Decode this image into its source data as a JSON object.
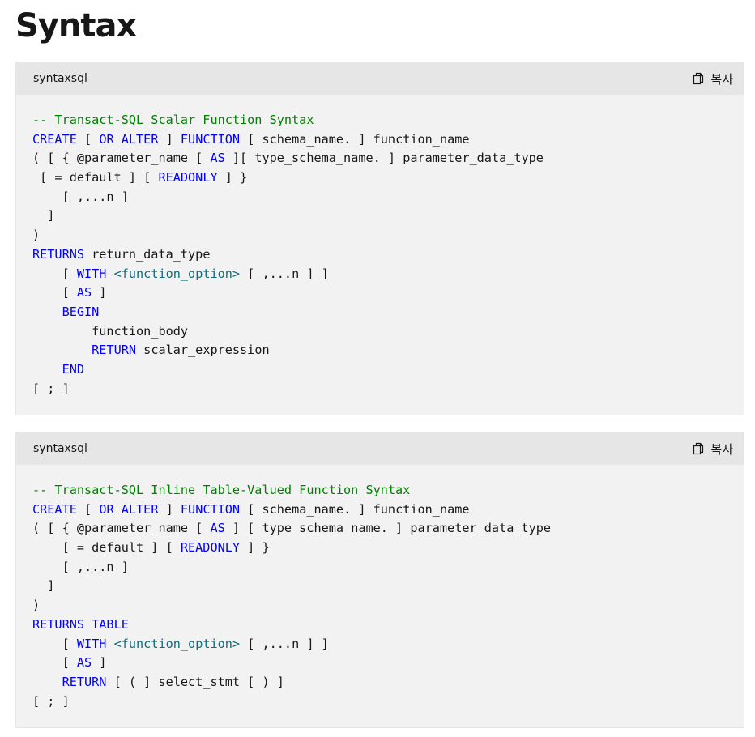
{
  "page": {
    "title": "Syntax"
  },
  "colors": {
    "keyword": "#0101fd",
    "comment": "#008000",
    "tag": "#0f6b7a",
    "text": "#171717",
    "block_bg": "#f2f2f2",
    "header_bg": "#e6e6e6"
  },
  "blocks": [
    {
      "lang": "syntaxsql",
      "copy_label": "복사",
      "copy_icon": "copy-icon",
      "lines": [
        [
          [
            "cm",
            "-- Transact-SQL Scalar Function Syntax"
          ]
        ],
        [
          [
            "kw",
            "CREATE"
          ],
          [
            "tx",
            " [ "
          ],
          [
            "kw",
            "OR ALTER"
          ],
          [
            "tx",
            " ] "
          ],
          [
            "kw",
            "FUNCTION"
          ],
          [
            "tx",
            " [ schema_name. ] function_name"
          ]
        ],
        [
          [
            "tx",
            "( [ { @parameter_name [ "
          ],
          [
            "kw",
            "AS"
          ],
          [
            "tx",
            " ][ type_schema_name. ] parameter_data_type"
          ]
        ],
        [
          [
            "tx",
            " [ = default ] [ "
          ],
          [
            "kw",
            "READONLY"
          ],
          [
            "tx",
            " ] }"
          ]
        ],
        [
          [
            "tx",
            "    [ ,...n ]"
          ]
        ],
        [
          [
            "tx",
            "  ]"
          ]
        ],
        [
          [
            "tx",
            ")"
          ]
        ],
        [
          [
            "kw",
            "RETURNS"
          ],
          [
            "tx",
            " return_data_type"
          ]
        ],
        [
          [
            "tx",
            "    [ "
          ],
          [
            "kw",
            "WITH"
          ],
          [
            "tx",
            " "
          ],
          [
            "tg",
            "<function_option>"
          ],
          [
            "tx",
            " [ ,...n ] ]"
          ]
        ],
        [
          [
            "tx",
            "    [ "
          ],
          [
            "kw",
            "AS"
          ],
          [
            "tx",
            " ]"
          ]
        ],
        [
          [
            "tx",
            "    "
          ],
          [
            "kw",
            "BEGIN"
          ]
        ],
        [
          [
            "tx",
            "        function_body"
          ]
        ],
        [
          [
            "tx",
            "        "
          ],
          [
            "kw",
            "RETURN"
          ],
          [
            "tx",
            " scalar_expression"
          ]
        ],
        [
          [
            "tx",
            "    "
          ],
          [
            "kw",
            "END"
          ]
        ],
        [
          [
            "tx",
            "[ ; ]"
          ]
        ]
      ]
    },
    {
      "lang": "syntaxsql",
      "copy_label": "복사",
      "copy_icon": "copy-icon",
      "lines": [
        [
          [
            "cm",
            "-- Transact-SQL Inline Table-Valued Function Syntax"
          ]
        ],
        [
          [
            "kw",
            "CREATE"
          ],
          [
            "tx",
            " [ "
          ],
          [
            "kw",
            "OR ALTER"
          ],
          [
            "tx",
            " ] "
          ],
          [
            "kw",
            "FUNCTION"
          ],
          [
            "tx",
            " [ schema_name. ] function_name"
          ]
        ],
        [
          [
            "tx",
            "( [ { @parameter_name [ "
          ],
          [
            "kw",
            "AS"
          ],
          [
            "tx",
            " ] [ type_schema_name. ] parameter_data_type"
          ]
        ],
        [
          [
            "tx",
            "    [ = default ] [ "
          ],
          [
            "kw",
            "READONLY"
          ],
          [
            "tx",
            " ] }"
          ]
        ],
        [
          [
            "tx",
            "    [ ,...n ]"
          ]
        ],
        [
          [
            "tx",
            "  ]"
          ]
        ],
        [
          [
            "tx",
            ")"
          ]
        ],
        [
          [
            "kw",
            "RETURNS TABLE"
          ]
        ],
        [
          [
            "tx",
            "    [ "
          ],
          [
            "kw",
            "WITH"
          ],
          [
            "tx",
            " "
          ],
          [
            "tg",
            "<function_option>"
          ],
          [
            "tx",
            " [ ,...n ] ]"
          ]
        ],
        [
          [
            "tx",
            "    [ "
          ],
          [
            "kw",
            "AS"
          ],
          [
            "tx",
            " ]"
          ]
        ],
        [
          [
            "tx",
            "    "
          ],
          [
            "kw",
            "RETURN"
          ],
          [
            "tx",
            " [ ( ] select_stmt [ ) ]"
          ]
        ],
        [
          [
            "tx",
            "[ ; ]"
          ]
        ]
      ]
    }
  ]
}
